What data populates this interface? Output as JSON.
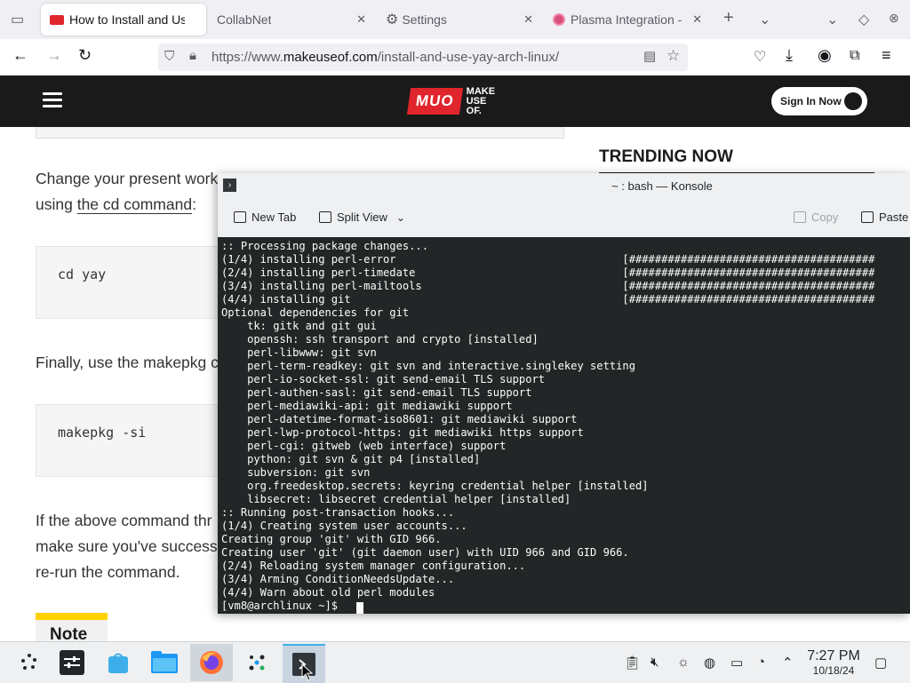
{
  "browser": {
    "tabs": [
      {
        "label": "How to Install and Us"
      },
      {
        "label": "CollabNet"
      },
      {
        "label": "Settings"
      },
      {
        "label": "Plasma Integration -"
      }
    ],
    "url_prefix": "https://www.",
    "url_domain": "makeuseof.com",
    "url_path": "/install-and-use-yay-arch-linux/"
  },
  "site": {
    "logo_mark": "MUO",
    "logo_word_1": "MAKE",
    "logo_word_2": "USE",
    "logo_word_3": "OF.",
    "signin_label": "Sign In Now",
    "trending_title": "TRENDING NOW"
  },
  "article": {
    "para1_line1": "Change your present work",
    "para1_line2": "using ",
    "para1_link": "the cd command",
    "para1_end": ":",
    "code1": "cd yay",
    "para2": "Finally, use the makepkg c",
    "code2": "makepkg -si",
    "para3_line1": "If the above command thr",
    "para3_line2": "make sure you've success",
    "para3_line3": "re-run the command.",
    "note_label": "Note"
  },
  "konsole": {
    "title": "~ : bash — Konsole",
    "new_tab": "New Tab",
    "split_view": "Split View",
    "copy": "Copy",
    "paste": "Paste",
    "prompt": "[vm8@archlinux ~]$ ",
    "lines": [
      ":: Processing package changes...",
      "(1/4) installing perl-error                                   [######################################",
      "(2/4) installing perl-timedate                                [######################################",
      "(3/4) installing perl-mailtools                               [######################################",
      "(4/4) installing git                                          [######################################",
      "Optional dependencies for git",
      "    tk: gitk and git gui",
      "    openssh: ssh transport and crypto [installed]",
      "    perl-libwww: git svn",
      "    perl-term-readkey: git svn and interactive.singlekey setting",
      "    perl-io-socket-ssl: git send-email TLS support",
      "    perl-authen-sasl: git send-email TLS support",
      "    perl-mediawiki-api: git mediawiki support",
      "    perl-datetime-format-iso8601: git mediawiki support",
      "    perl-lwp-protocol-https: git mediawiki https support",
      "    perl-cgi: gitweb (web interface) support",
      "    python: git svn & git p4 [installed]",
      "    subversion: git svn",
      "    org.freedesktop.secrets: keyring credential helper [installed]",
      "    libsecret: libsecret credential helper [installed]",
      ":: Running post-transaction hooks...",
      "(1/4) Creating system user accounts...",
      "Creating group 'git' with GID 966.",
      "Creating user 'git' (git daemon user) with UID 966 and GID 966.",
      "(2/4) Reloading system manager configuration...",
      "(3/4) Arming ConditionNeedsUpdate...",
      "(4/4) Warn about old perl modules"
    ]
  },
  "taskbar": {
    "time": "7:27 PM",
    "date": "10/18/24"
  }
}
